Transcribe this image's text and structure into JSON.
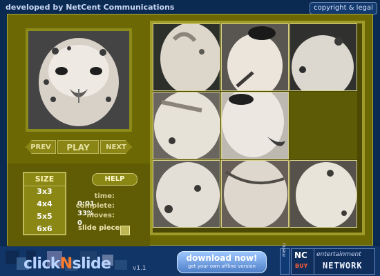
{
  "header": {
    "developer_text": "developed by NetCent Communications",
    "copyright_label": "copyright & legal"
  },
  "controls": {
    "prev_label": "PREV",
    "play_label": "PLAY",
    "next_label": "NEXT",
    "size_title": "SIZE",
    "size_options": [
      "3x3",
      "4x4",
      "5x5",
      "6x6"
    ],
    "help_label": "HELP",
    "stats": {
      "time_label": "time:",
      "time_value": "0:01",
      "complete_label": "complete:",
      "complete_value": "33%",
      "moves_label": "moves:",
      "moves_value": "0"
    },
    "slide_pieces_label": "slide pieces"
  },
  "footer": {
    "logo_prefix": "click",
    "logo_mid": "N",
    "logo_suffix": "slide",
    "version": "v1.1",
    "download_title": "download now!",
    "download_subtitle": "get your own offline version",
    "menu_label": "menu",
    "brand_nc": "NC",
    "brand_buy": "BUY",
    "brand_entertainment": "entertainment",
    "brand_network": "NETWORK"
  }
}
